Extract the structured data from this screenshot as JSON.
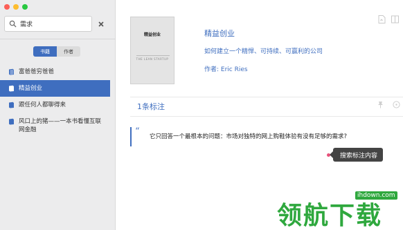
{
  "sidebar": {
    "search": {
      "value": "需求"
    },
    "segments": [
      {
        "label": "书籍",
        "active": true
      },
      {
        "label": "作者",
        "active": false
      }
    ],
    "books": [
      {
        "title": "富爸爸穷爸爸",
        "selected": false
      },
      {
        "title": "精益创业",
        "selected": true
      },
      {
        "title": "跟任何人都聊得来",
        "selected": false
      },
      {
        "title": "风口上的猪——一本书看懂互联网金融",
        "selected": false
      }
    ]
  },
  "main": {
    "cover": {
      "title": "精益创业",
      "subtitle": "THE LEAN STARTUP"
    },
    "book_title": "精益创业",
    "book_subtitle": "如何建立一个精悍、可持续、可赢利的公司",
    "author": "作者: Eric Ries",
    "annotation_count": "1条标注",
    "quote_mark": "“",
    "quote": "它只回答一个最根本的问题：市场对独特的网上购鞋体验有没有足够的需求?",
    "tooltip": "搜索标注内容"
  },
  "watermark": {
    "url": "ihdown.com",
    "logo": "领航下载"
  },
  "colors": {
    "accent": "#3f6ebf",
    "sidebar_bg": "#ececed",
    "highlight_dot": "#e8507a",
    "watermark": "#2fa83e"
  }
}
